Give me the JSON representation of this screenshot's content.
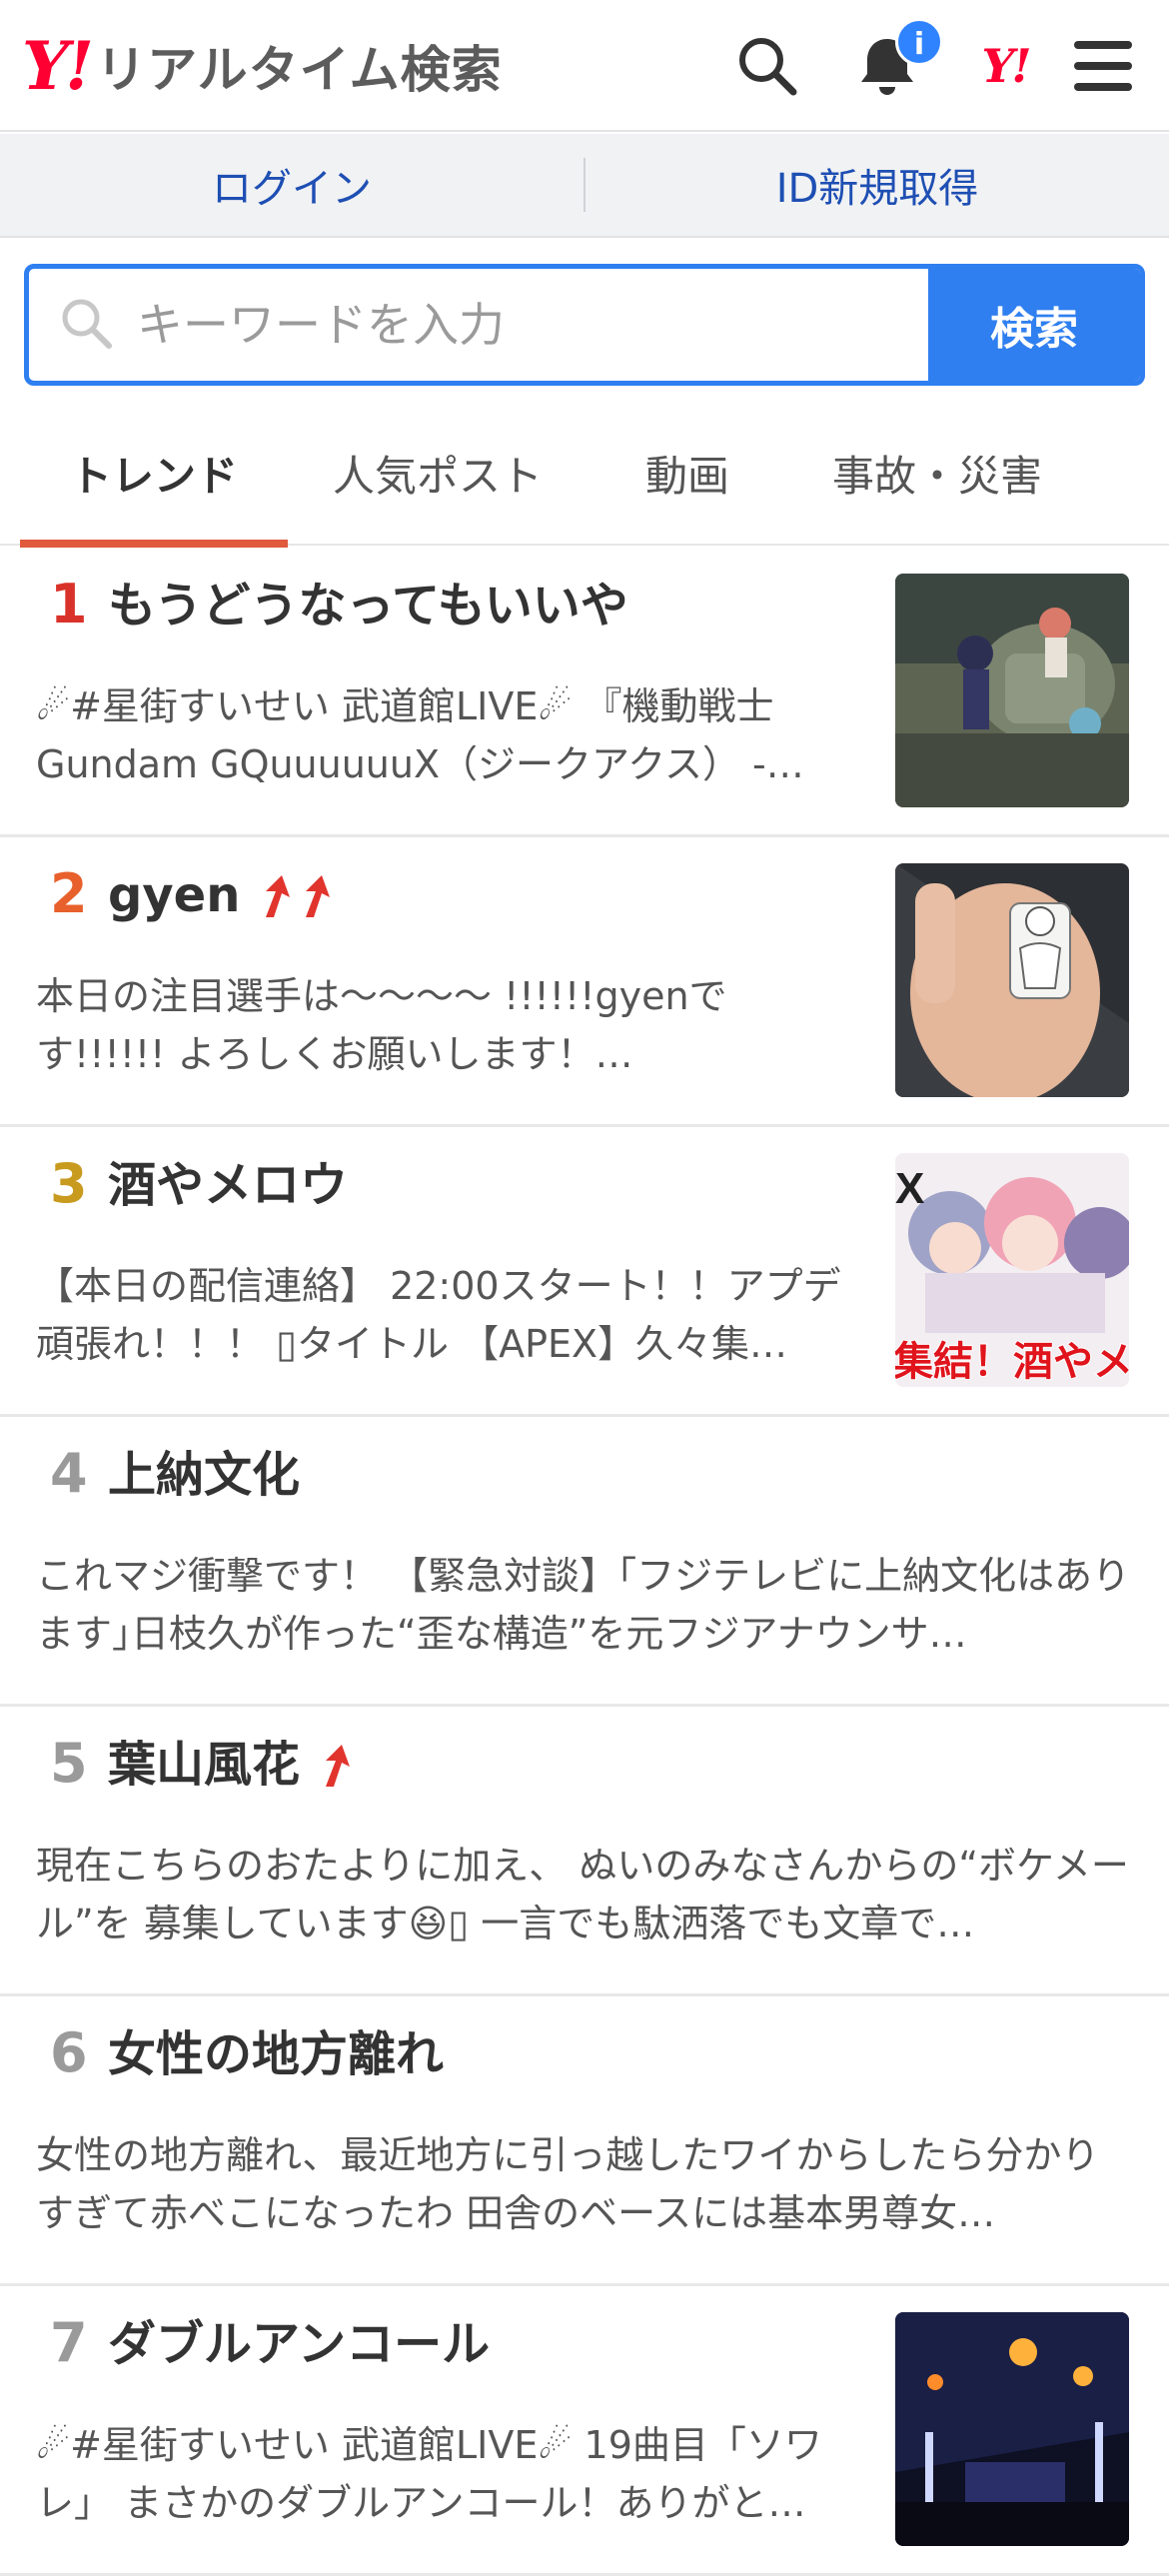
{
  "header": {
    "logo_y": "Y!",
    "logo_text": "リアルタイム検索",
    "notification_badge": "i",
    "yahoo_mark": "Y!"
  },
  "login_bar": {
    "login_label": "ログイン",
    "register_label": "ID新規取得"
  },
  "search": {
    "placeholder": "キーワードを入力",
    "button_label": "検索"
  },
  "tabs": [
    {
      "label": "トレンド",
      "active": true
    },
    {
      "label": "人気ポスト",
      "active": false
    },
    {
      "label": "動画",
      "active": false
    },
    {
      "label": "事故・災害",
      "active": false
    }
  ],
  "colors": {
    "accent_blue": "#2f7ff0",
    "yahoo_red": "#ff0033",
    "rank1": "#d9322b",
    "rank2": "#e8602c",
    "rank3": "#c89a1e",
    "rank_other": "#9a9a9a",
    "tab_underline": "#e05a3c"
  },
  "trends": [
    {
      "rank": "1",
      "title": "もうどうなってもいいや",
      "desc": "☄#星街すいせい 武道館LIVE☄ 『機動戦士Gundam GQuuuuuuX（ジークアクス） -…",
      "rising": 0,
      "thumbnail": true
    },
    {
      "rank": "2",
      "title": "gyen",
      "desc": "本日の注目選手は〜〜〜〜 !!!!!!gyenです!!!!!! よろしくお願いします！…",
      "rising": 2,
      "thumbnail": true
    },
    {
      "rank": "3",
      "title": "酒やメロウ",
      "desc": "【本日の配信連絡】 22:00スタート！！アプデ頑張れ！！！ ▯タイトル 【APEX】久々集…",
      "rising": 0,
      "thumbnail": true,
      "thumbnail_caption": "集結！酒やメロウ"
    },
    {
      "rank": "4",
      "title": "上納文化",
      "desc": "これマジ衝撃です！ 【緊急対談】｢フジテレビに上納文化はあります｣日枝久が作った“歪な構造”を元フジアナウンサ…",
      "rising": 0,
      "thumbnail": false
    },
    {
      "rank": "5",
      "title": "葉山風花",
      "desc": "現在こちらのおたよりに加え、 ぬいのみなさんからの“ボケメール”を 募集しています😆▯ 一言でも駄洒落でも文章で…",
      "rising": 1,
      "thumbnail": false
    },
    {
      "rank": "6",
      "title": "女性の地方離れ",
      "desc": "女性の地方離れ、最近地方に引っ越したワイからしたら分かりすぎて赤べこになったわ 田舎のベースには基本男尊女…",
      "rising": 0,
      "thumbnail": false
    },
    {
      "rank": "7",
      "title": "ダブルアンコール",
      "desc": "☄#星街すいせい 武道館LIVE☄ 19曲目「ソワレ」 まさかのダブルアンコール！ありがと…",
      "rising": 0,
      "thumbnail": true
    }
  ]
}
